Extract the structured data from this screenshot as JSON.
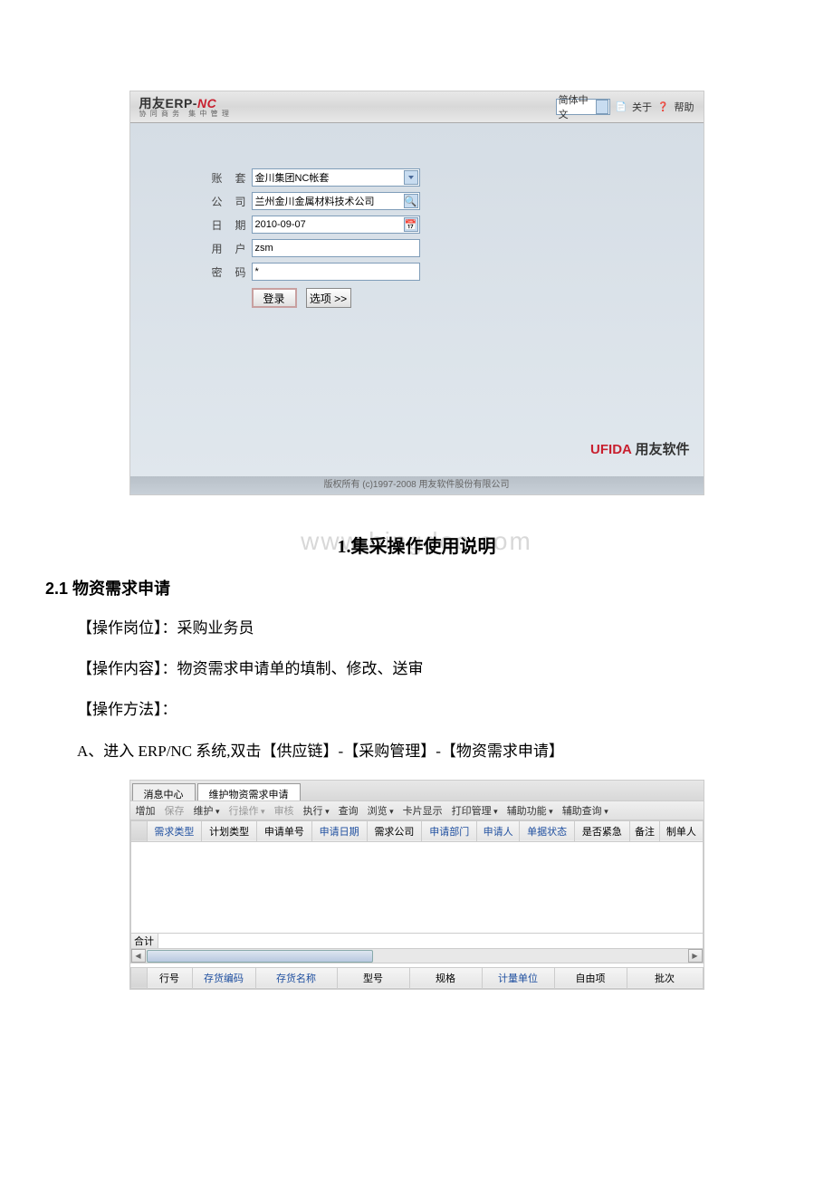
{
  "login": {
    "logo_main": "用友ERP-",
    "logo_nc": "NC",
    "logo_sub": "协 同 商 务　集 中 管 理",
    "lang": "简体中文",
    "about": "关于",
    "help": "帮助",
    "fields": {
      "account_label": "账 套",
      "account_value": "金川集团NC帐套",
      "company_label": "公 司",
      "company_value": "兰州金川金属材料技术公司",
      "date_label": "日 期",
      "date_value": "2010-09-07",
      "user_label": "用 户",
      "user_value": "zsm",
      "password_label": "密 码",
      "password_value": "*"
    },
    "login_btn": "登录",
    "options_btn": "选项 >>",
    "brand_ufida": "UFIDA",
    "brand_cn": "用友软件",
    "copyright": "版权所有  (c)1997-2008 用友软件股份有限公司"
  },
  "doc": {
    "watermark": "www.bingdoc.com",
    "title1": "1.集采操作使用说明",
    "heading21": "2.1 物资需求申请",
    "line_role": "【操作岗位】：采购业务员",
    "line_content": "【操作内容】：物资需求申请单的填制、修改、送审",
    "line_method": "【操作方法】：",
    "line_step_a": "A、进入 ERP/NC 系统,双击【供应链】-【采购管理】-【物资需求申请】"
  },
  "grid": {
    "tab1": "消息中心",
    "tab2": "维护物资需求申请",
    "toolbar": {
      "add": "增加",
      "save": "保存",
      "maintain": "维护",
      "rowop": "行操作",
      "audit": "审核",
      "exec": "执行",
      "query": "查询",
      "browse": "浏览",
      "card": "卡片显示",
      "print": "打印管理",
      "aux": "辅助功能",
      "auxq": "辅助查询"
    },
    "cols1": [
      "需求类型",
      "计划类型",
      "申请单号",
      "申请日期",
      "需求公司",
      "申请部门",
      "申请人",
      "单据状态",
      "是否紧急",
      "备注",
      "制单人"
    ],
    "total": "合计",
    "cols2": [
      "行号",
      "存货编码",
      "存货名称",
      "型号",
      "规格",
      "计量单位",
      "自由项",
      "批次"
    ]
  }
}
